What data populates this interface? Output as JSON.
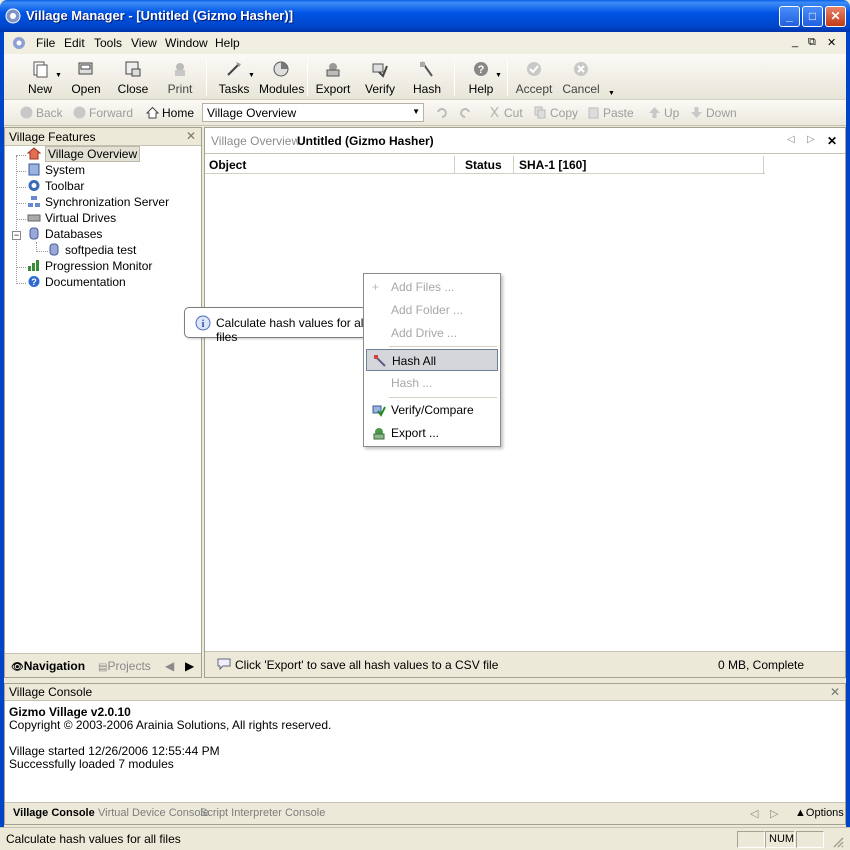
{
  "window": {
    "title": "Village Manager - [Untitled (Gizmo Hasher)]",
    "minimize_glyph": "_",
    "maximize_glyph": "□",
    "close_glyph": "✕"
  },
  "menubar": {
    "items": [
      "File",
      "Edit",
      "Tools",
      "View",
      "Window",
      "Help"
    ],
    "mdi_controls": [
      "_",
      "⧉",
      "✕"
    ]
  },
  "toolbar": {
    "buttons": [
      {
        "label": "New",
        "icon": "new-icon",
        "has_dropdown": true
      },
      {
        "label": "Open",
        "icon": "open-icon"
      },
      {
        "label": "Close",
        "icon": "close-doc-icon"
      },
      {
        "label": "Print",
        "icon": "print-icon",
        "disabled": true
      },
      {
        "label": "Tasks",
        "icon": "tasks-icon",
        "has_dropdown": true
      },
      {
        "label": "Modules",
        "icon": "modules-icon"
      },
      {
        "label": "Export",
        "icon": "export-icon"
      },
      {
        "label": "Verify",
        "icon": "verify-icon"
      },
      {
        "label": "Hash",
        "icon": "hash-icon"
      },
      {
        "label": "Help",
        "icon": "help-icon",
        "has_dropdown": true
      },
      {
        "label": "Accept",
        "icon": "accept-icon",
        "disabled": true
      },
      {
        "label": "Cancel",
        "icon": "cancel-icon",
        "disabled": true
      }
    ]
  },
  "navbar": {
    "back": "Back",
    "forward": "Forward",
    "home": "Home",
    "address": "Village Overview",
    "cut": "Cut",
    "copy": "Copy",
    "paste": "Paste",
    "up": "Up",
    "down": "Down"
  },
  "left_pane": {
    "title": "Village Features",
    "tree": [
      {
        "label": "Village Overview",
        "icon": "village-overview-icon",
        "selected": true
      },
      {
        "label": "System",
        "icon": "system-icon"
      },
      {
        "label": "Toolbar",
        "icon": "toolbar-icon"
      },
      {
        "label": "Synchronization Server",
        "icon": "sync-server-icon"
      },
      {
        "label": "Virtual Drives",
        "icon": "virtual-drives-icon"
      },
      {
        "label": "Databases",
        "icon": "databases-icon",
        "expanded": true
      },
      {
        "label": "softpedia test",
        "icon": "database-icon"
      },
      {
        "label": "Progression Monitor",
        "icon": "progression-monitor-icon"
      },
      {
        "label": "Documentation",
        "icon": "documentation-icon"
      }
    ],
    "footer_tabs": [
      "Navigation",
      "Projects"
    ]
  },
  "main": {
    "tabs": [
      "Village Overview",
      "Untitled (Gizmo Hasher)"
    ],
    "columns": [
      "Object",
      "Status",
      "SHA-1 [160]"
    ],
    "status_message": "Click 'Export' to save all hash values to a CSV file",
    "status_right": "0 MB, Complete"
  },
  "context_menu": {
    "items": [
      {
        "label": "Add Files ...",
        "disabled": true
      },
      {
        "label": "Add Folder ...",
        "disabled": true
      },
      {
        "label": "Add Drive ...",
        "disabled": true
      },
      {
        "label": "Hash All",
        "hover": true
      },
      {
        "label": "Hash ...",
        "disabled": true
      },
      {
        "label": "Verify/Compare"
      },
      {
        "label": "Export ..."
      }
    ]
  },
  "tooltip": {
    "text": "Calculate hash values for all files"
  },
  "console": {
    "title": "Village Console",
    "lines": [
      "Gizmo Village v2.0.10",
      "Copyright © 2003-2006 Arainia Solutions, All rights reserved.",
      "",
      "Village started 12/26/2006 12:55:44 PM",
      "Successfully loaded 7 modules"
    ],
    "tabs": [
      "Village Console",
      "Virtual Device Console",
      "Script Interpreter Console"
    ],
    "options": "Options"
  },
  "statusbar": {
    "message": "Calculate hash values for all files",
    "num": "NUM"
  },
  "colors": {
    "title_blue": "#0055e5",
    "chrome": "#ece9d8",
    "hover_fill": "#d4d6da",
    "disabled_text": "#a7a7a7"
  }
}
